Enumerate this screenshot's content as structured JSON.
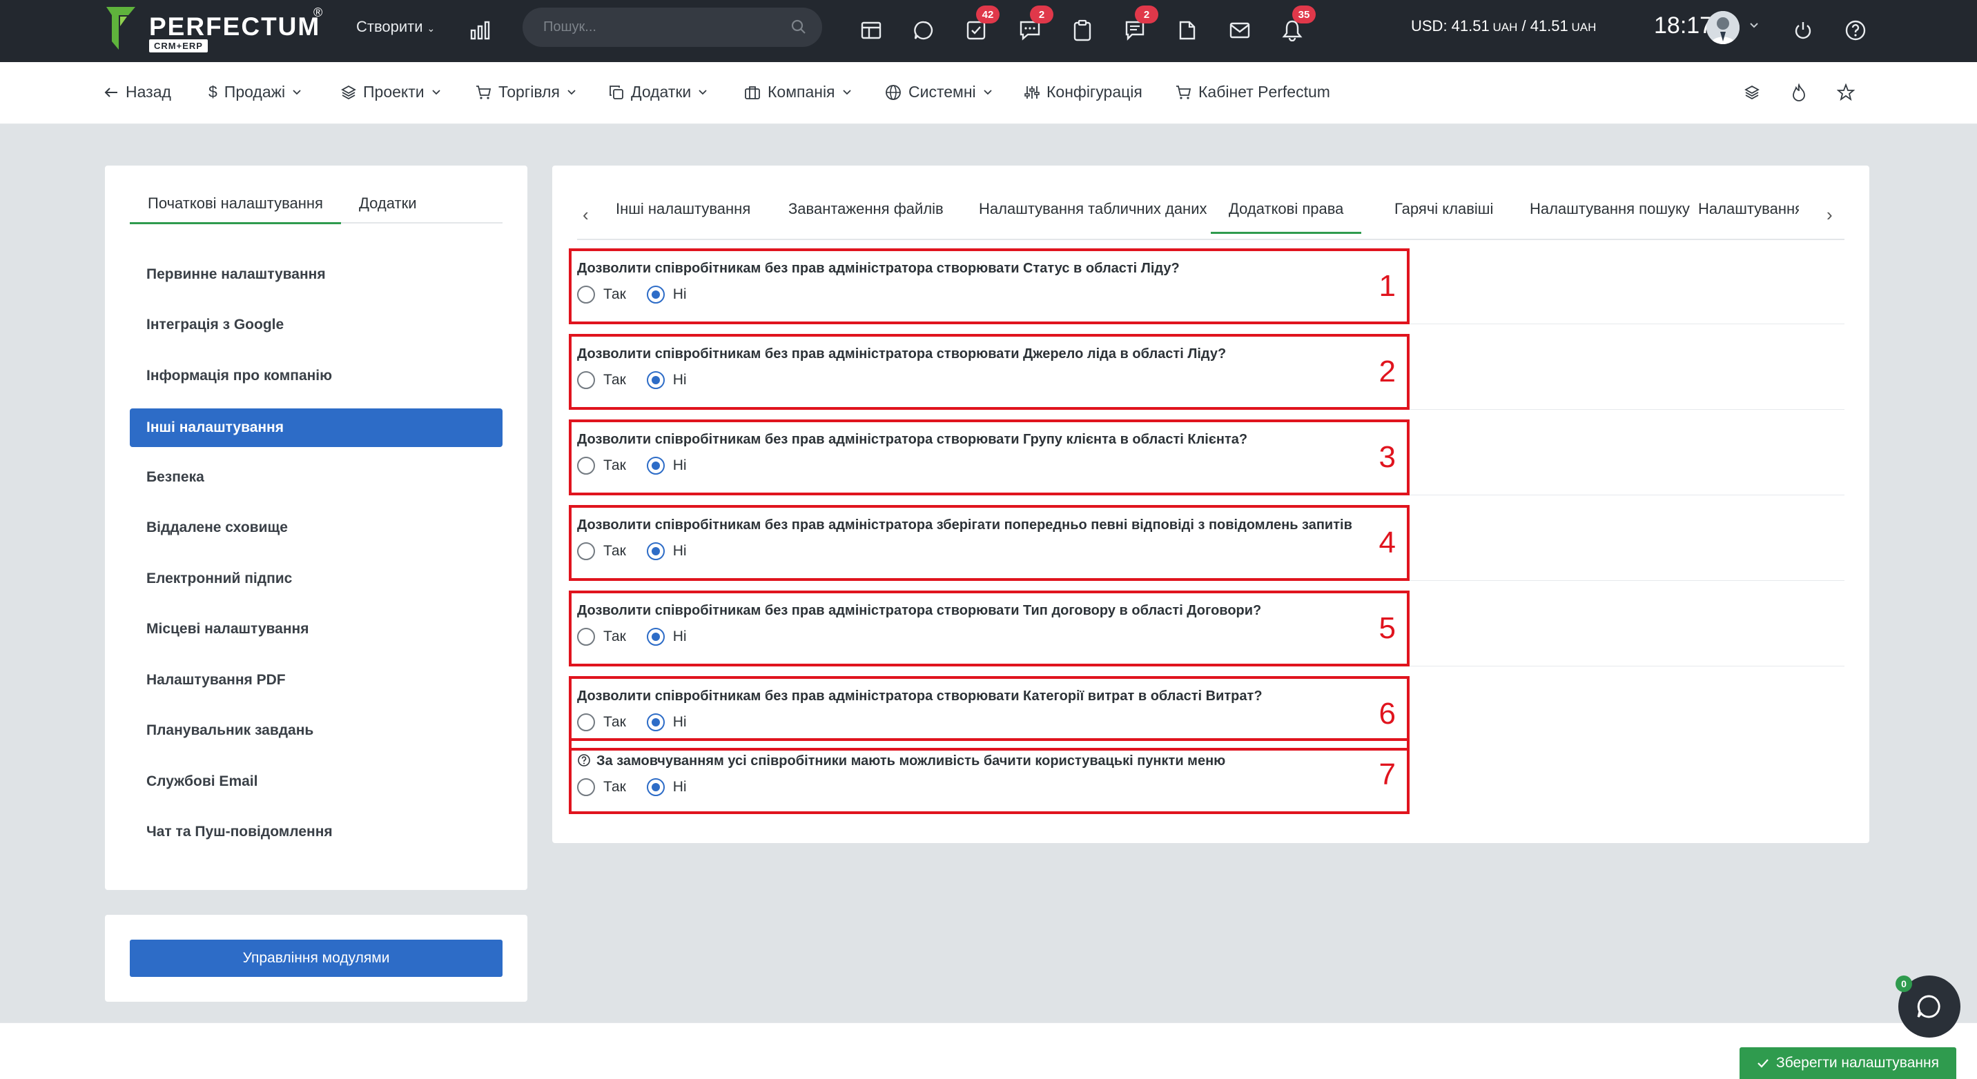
{
  "topbar": {
    "brand": "PERFECTUM",
    "brand_sub": "CRM+ERP",
    "brand_reg": "®",
    "create_label": "Створити",
    "search_placeholder": "Пошук...",
    "badges": {
      "tasks": "42",
      "chat": "2",
      "notes": "2",
      "notifications": "35"
    },
    "currency_prefix": "USD: 41.51",
    "currency_unit1": " UAH",
    "currency_mid": " / 41.51",
    "currency_unit2": " UAH",
    "time": "18:17"
  },
  "nav": {
    "back": "Назад",
    "sales": "Продажі",
    "projects": "Проекти",
    "trade": "Торгівля",
    "addons": "Додатки",
    "company": "Компанія",
    "system": "Системні",
    "config": "Конфігурація",
    "cabinet": "Кабінет Perfectum"
  },
  "left": {
    "tabs": [
      "Початкові налаштування",
      "Додатки"
    ],
    "items": [
      "Первинне налаштування",
      "Інтеграція з Google",
      "Інформація про компанію",
      "Інші налаштування",
      "Безпека",
      "Віддалене сховище",
      "Електронний підпис",
      "Місцеві налаштування",
      "Налаштування PDF",
      "Планувальник завдань",
      "Службові Email",
      "Чат та Пуш-повідомлення"
    ],
    "modules_button": "Управління модулями"
  },
  "tabs": [
    "Інші налаштування",
    "Завантаження файлів",
    "Налаштування табличних даних",
    "Додаткові права",
    "Гарячі клавіші",
    "Налаштування пошуку",
    "Налаштування"
  ],
  "options": [
    {
      "question": "Дозволити співробітникам без прав адміністратора створювати Статус в області Ліду?",
      "yes": "Так",
      "no": "Ні",
      "selected": "no",
      "marker": "1"
    },
    {
      "question": "Дозволити співробітникам без прав адміністратора створювати Джерело ліда в області Ліду?",
      "yes": "Так",
      "no": "Ні",
      "selected": "no",
      "marker": "2"
    },
    {
      "question": "Дозволити співробітникам без прав адміністратора створювати Групу клієнта в області Клієнта?",
      "yes": "Так",
      "no": "Ні",
      "selected": "no",
      "marker": "3"
    },
    {
      "question": "Дозволити співробітникам без прав адміністратора зберігати попередньо певні відповіді з повідомлень запитів",
      "yes": "Так",
      "no": "Ні",
      "selected": "no",
      "marker": "4"
    },
    {
      "question": "Дозволити співробітникам без прав адміністратора створювати Тип договору в області Договори?",
      "yes": "Так",
      "no": "Ні",
      "selected": "no",
      "marker": "5"
    },
    {
      "question": "Дозволити співробітникам без прав адміністратора створювати Категорії витрат в області Витрат?",
      "yes": "Так",
      "no": "Ні",
      "selected": "no",
      "marker": "6"
    },
    {
      "question": "За замовчуванням усі співробітники мають можливість бачити користувацькі пункти меню",
      "yes": "Так",
      "no": "Ні",
      "selected": "no",
      "marker": "7"
    }
  ],
  "save_button": "Зберегти налаштування",
  "chat_count": "0",
  "colors": {
    "accent_blue": "#2d6cc7",
    "accent_green": "#2f9b4e",
    "annotation_red": "#e0141e",
    "topbar": "#23282f"
  }
}
